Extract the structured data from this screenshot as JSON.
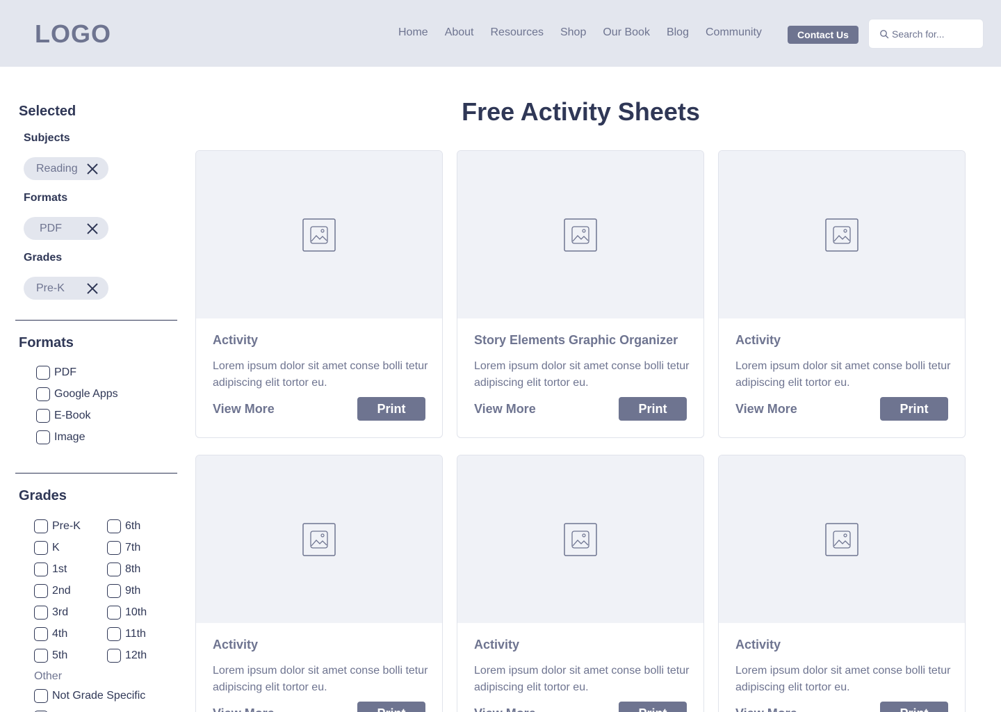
{
  "header": {
    "logo": "LOGO",
    "nav": [
      "Home",
      "About",
      "Resources",
      "Shop",
      "Our Book",
      "Blog",
      "Community"
    ],
    "contact_label": "Contact Us",
    "search_placeholder": "Search for..."
  },
  "sidebar": {
    "selected": {
      "title": "Selected",
      "groups": [
        {
          "label": "Subjects",
          "chip": "Reading"
        },
        {
          "label": "Formats",
          "chip": "PDF"
        },
        {
          "label": "Grades",
          "chip": "Pre-K"
        }
      ]
    },
    "formats": {
      "title": "Formats",
      "options": [
        "PDF",
        "Google Apps",
        "E-Book",
        "Image"
      ]
    },
    "grades": {
      "title": "Grades",
      "col1": [
        "Pre-K",
        "K",
        "1st",
        "2nd",
        "3rd",
        "4th",
        "5th"
      ],
      "col2": [
        "6th",
        "7th",
        "8th",
        "9th",
        "10th",
        "11th",
        "12th"
      ],
      "other_label": "Other",
      "other_options": [
        "Not Grade Specific"
      ]
    }
  },
  "main": {
    "title": "Free Activity Sheets",
    "cards": [
      {
        "title": "Activity",
        "desc": "Lorem ipsum dolor sit amet conse bolli tetur adipiscing elit tortor eu.",
        "view_more": "View More",
        "print": "Print"
      },
      {
        "title": "Story Elements Graphic Organizer",
        "desc": "Lorem ipsum dolor sit amet conse bolli tetur adipiscing elit tortor eu.",
        "view_more": "View More",
        "print": "Print"
      },
      {
        "title": "Activity",
        "desc": "Lorem ipsum dolor sit amet conse bolli tetur adipiscing elit tortor eu.",
        "view_more": "View More",
        "print": "Print"
      },
      {
        "title": "Activity",
        "desc": "Lorem ipsum dolor sit amet conse bolli tetur adipiscing elit tortor eu.",
        "view_more": "View More",
        "print": "Print"
      },
      {
        "title": "Activity",
        "desc": "Lorem ipsum dolor sit amet conse bolli tetur adipiscing elit tortor eu.",
        "view_more": "View More",
        "print": "Print"
      },
      {
        "title": "Activity",
        "desc": "Lorem ipsum dolor sit amet conse bolli tetur adipiscing elit tortor eu.",
        "view_more": "View More",
        "print": "Print"
      }
    ]
  },
  "colors": {
    "header_bg": "#e3e6ee",
    "accent": "#6e7490",
    "text_dark": "#2f3756"
  }
}
